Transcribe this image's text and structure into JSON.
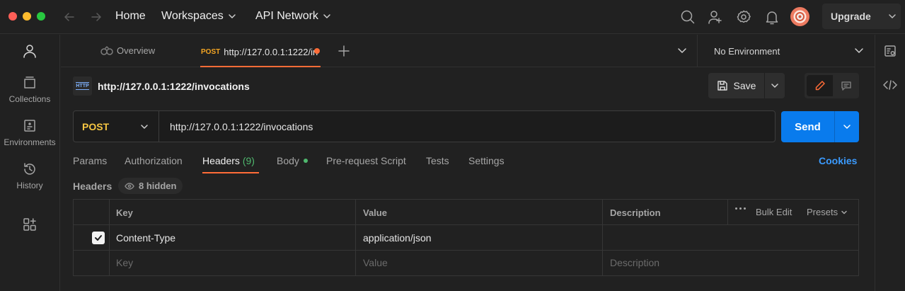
{
  "topbar": {
    "nav": {
      "home": "Home",
      "workspaces": "Workspaces",
      "api_network": "API Network"
    },
    "upgrade_label": "Upgrade",
    "colors": {
      "close": "#ff5f57",
      "minimize": "#febc2e",
      "maximize": "#28c840"
    }
  },
  "sidebar": {
    "items": [
      {
        "label": "Collections",
        "icon": "collections-icon"
      },
      {
        "label": "Environments",
        "icon": "environments-icon"
      },
      {
        "label": "History",
        "icon": "history-icon"
      }
    ]
  },
  "tabs": {
    "overview": "Overview",
    "active": {
      "method": "POST",
      "title": "http://127.0.0.1:1222/in"
    },
    "environment": "No Environment"
  },
  "request": {
    "title": "http://127.0.0.1:1222/invocations",
    "http_icon_text": "HTTP",
    "save_label": "Save",
    "method": "POST",
    "url": "http://127.0.0.1:1222/invocations",
    "send_label": "Send",
    "tabs": [
      {
        "label": "Params"
      },
      {
        "label": "Authorization"
      },
      {
        "label": "Headers",
        "count": "(9)"
      },
      {
        "label": "Body"
      },
      {
        "label": "Pre-request Script"
      },
      {
        "label": "Tests"
      },
      {
        "label": "Settings"
      }
    ],
    "cookies_label": "Cookies"
  },
  "headers": {
    "section_label": "Headers",
    "hidden_label": "8 hidden",
    "columns": {
      "key": "Key",
      "value": "Value",
      "description": "Description"
    },
    "bulk_edit": "Bulk Edit",
    "presets": "Presets",
    "rows": [
      {
        "checked": true,
        "key": "Content-Type",
        "value": "application/json",
        "description": ""
      }
    ],
    "placeholders": {
      "key": "Key",
      "value": "Value",
      "description": "Description"
    }
  }
}
